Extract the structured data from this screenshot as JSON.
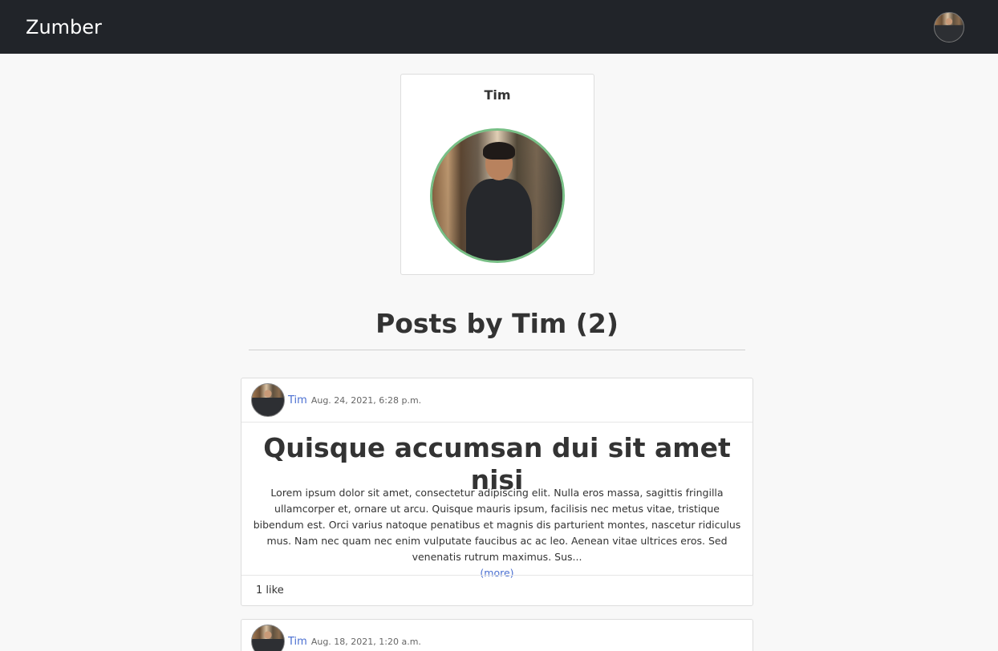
{
  "navbar": {
    "brand": "Zumber",
    "avatar_icon": "user-avatar-icon"
  },
  "profile": {
    "name": "Tim",
    "photo_icon": "profile-photo"
  },
  "posts_section": {
    "title": "Posts by Tim (2)"
  },
  "posts": [
    {
      "author": "Tim",
      "date": "Aug. 24, 2021, 6:28 p.m.",
      "title": "Quisque accumsan dui sit amet nisi",
      "body": "Lorem ipsum dolor sit amet, consectetur adipiscing elit. Nulla eros massa, sagittis fringilla ullamcorper et, ornare ut arcu. Quisque mauris ipsum, facilisis nec metus vitae, tristique bibendum est. Orci varius natoque penatibus et magnis dis parturient montes, nascetur ridiculus mus. Nam nec quam nec enim vulputate faucibus ac ac leo. Aenean vitae ultrices eros. Sed venenatis rutrum maximus. Sus...",
      "more_label": "(more)",
      "likes": "1 like"
    },
    {
      "author": "Tim",
      "date": "Aug. 18, 2021, 1:20 a.m."
    }
  ],
  "colors": {
    "navbar_bg": "#212429",
    "link": "#4a6fd1",
    "avatar_ring": "#78bf86",
    "page_bg": "#f8f8f8"
  }
}
